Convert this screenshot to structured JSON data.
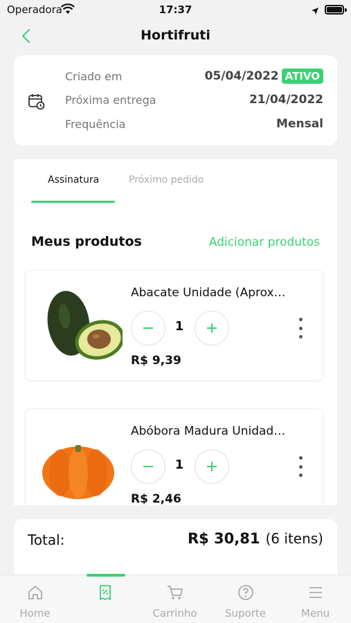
{
  "status_bar": {
    "carrier": "Operadora",
    "time": "17:37"
  },
  "header": {
    "title": "Hortifruti"
  },
  "subscription": {
    "created_label": "Criado em",
    "created_value": "05/04/2022",
    "status_badge": "ATIVO",
    "next_delivery_label": "Próxima entrega",
    "next_delivery_value": "21/04/2022",
    "frequency_label": "Frequência",
    "frequency_value": "Mensal"
  },
  "tabs": [
    {
      "label": "Assinatura",
      "active": true
    },
    {
      "label": "Próximo pedido",
      "active": false
    }
  ],
  "products_section": {
    "title": "Meus produtos",
    "add_label": "Adicionar produtos"
  },
  "products": [
    {
      "name": "Abacate Unidade (Aprox…",
      "quantity": "1",
      "price": "R$ 9,39",
      "image": "avocado"
    },
    {
      "name": "Abóbora Madura Unidad…",
      "quantity": "1",
      "price": "R$ 2,46",
      "image": "pumpkin"
    }
  ],
  "summary": {
    "total_label": "Total:",
    "total_value": "R$ 30,81",
    "items_count": "(6 itens)"
  },
  "tab_bar": [
    {
      "label": "Home",
      "icon": "home-icon"
    },
    {
      "label": "",
      "icon": "subscription-icon",
      "active": true
    },
    {
      "label": "Carrinho",
      "icon": "cart-icon"
    },
    {
      "label": "Suporte",
      "icon": "help-icon"
    },
    {
      "label": "Menu",
      "icon": "menu-icon"
    }
  ],
  "colors": {
    "accent": "#39d173",
    "background": "#f2f2f2",
    "muted_text": "#aaaaaa"
  }
}
